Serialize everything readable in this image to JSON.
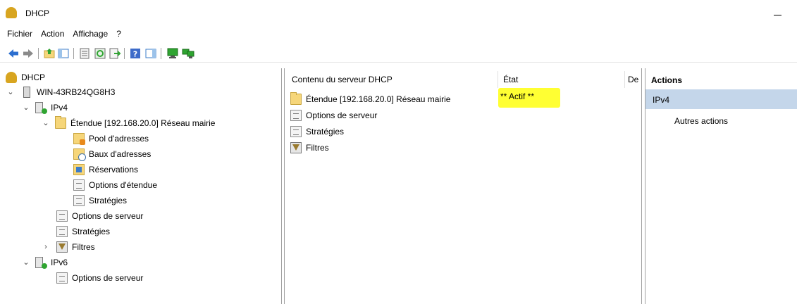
{
  "window": {
    "title": "DHCP"
  },
  "menu": [
    "Fichier",
    "Action",
    "Affichage",
    "?"
  ],
  "tree": {
    "root": "DHCP",
    "server": "WIN-43RB24QG8H3",
    "ipv4": "IPv4",
    "scope": "Étendue [192.168.20.0] Réseau mairie",
    "scope_children": [
      "Pool d'adresses",
      "Baux d'adresses",
      "Réservations",
      "Options d'étendue",
      "Stratégies"
    ],
    "ipv4_children": [
      "Options de serveur",
      "Stratégies",
      "Filtres"
    ],
    "ipv6": "IPv6",
    "ipv6_children": [
      "Options de serveur"
    ]
  },
  "content": {
    "columns": [
      "Contenu du serveur DHCP",
      "État",
      "De"
    ],
    "rows": [
      {
        "name": "Étendue [192.168.20.0] Réseau mairie",
        "state": "** Actif **"
      },
      {
        "name": "Options de serveur",
        "state": ""
      },
      {
        "name": "Stratégies",
        "state": ""
      },
      {
        "name": "Filtres",
        "state": ""
      }
    ]
  },
  "actions": {
    "header": "Actions",
    "section": "IPv4",
    "link": "Autres actions"
  },
  "colors": {
    "highlight": "#ffff33",
    "actions_section_bg": "#c4d6ea"
  }
}
